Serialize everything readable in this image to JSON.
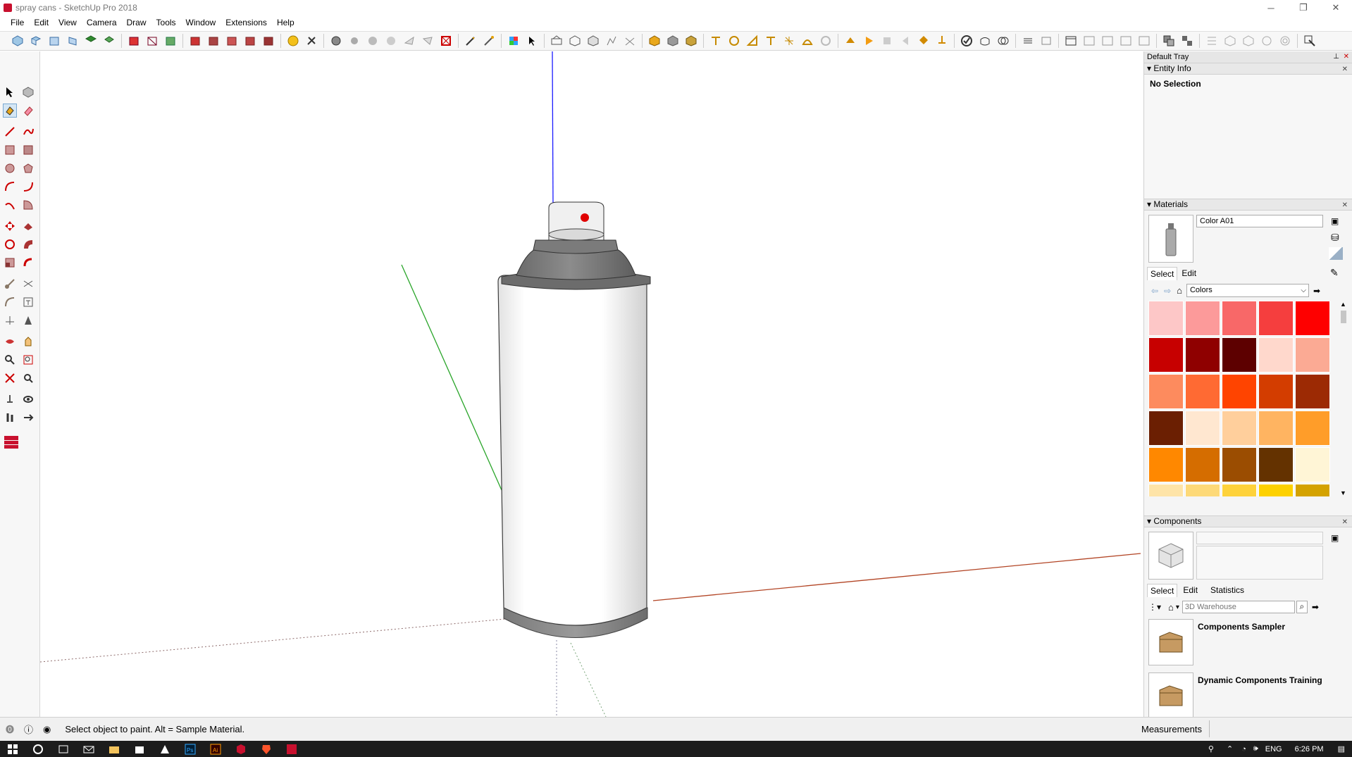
{
  "window": {
    "title": "spray cans - SketchUp Pro 2018",
    "minimize_glyph": "─",
    "maximize_glyph": "❐",
    "close_glyph": "✕"
  },
  "menu": {
    "items": [
      "File",
      "Edit",
      "View",
      "Camera",
      "Draw",
      "Tools",
      "Window",
      "Extensions",
      "Help"
    ]
  },
  "status": {
    "message": "Select object to paint. Alt = Sample Material.",
    "measurements_label": "Measurements",
    "measurements_value": ""
  },
  "tray": {
    "title": "Default Tray",
    "entity_info": {
      "title": "Entity Info",
      "selection": "No Selection"
    },
    "materials": {
      "title": "Materials",
      "name": "Color A01",
      "tabs": [
        "Select",
        "Edit"
      ],
      "library": "Colors",
      "colors": [
        "#fdc7c7",
        "#fc9a9a",
        "#f86868",
        "#f53e3e",
        "#fe0000",
        "#c70000",
        "#8f0000",
        "#5d0000",
        "#ffd8cc",
        "#fbaa94",
        "#fd8b5e",
        "#ff6a33",
        "#ff4400",
        "#d33d00",
        "#9c2a04",
        "#6b1f02",
        "#ffe7d0",
        "#ffcf9c",
        "#ffb461",
        "#ff9d29",
        "#ff8800",
        "#d56d00",
        "#9b4d01",
        "#643200",
        "#fff5d6",
        "#fee4a8",
        "#fdd978",
        "#fed23b",
        "#fdd100",
        "#d4a200"
      ]
    },
    "components": {
      "title": "Components",
      "tabs": [
        "Select",
        "Edit",
        "Statistics"
      ],
      "search_placeholder": "3D Warehouse",
      "items": [
        "Components Sampler",
        "Dynamic Components Training"
      ]
    }
  },
  "taskbar": {
    "lang": "ENG",
    "time": "6:26 PM"
  },
  "colors": {
    "axis_blue": "#0000ff",
    "axis_green": "#1d9c1d",
    "axis_red": "#b02e1a",
    "nozzle_dot": "#e00000"
  }
}
